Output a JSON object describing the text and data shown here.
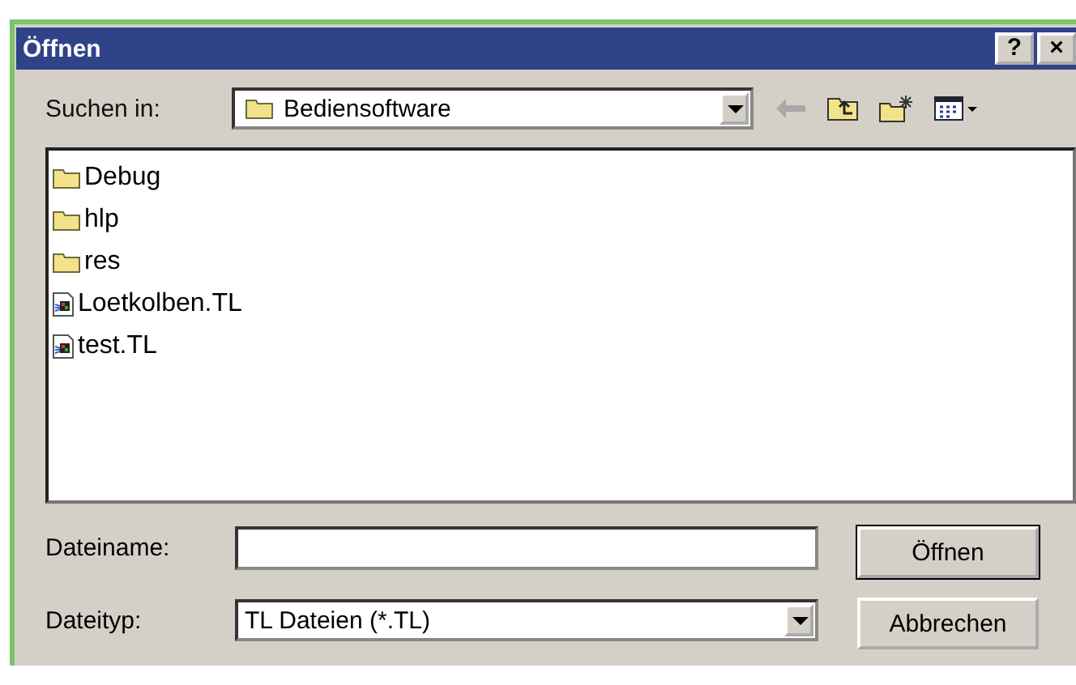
{
  "window": {
    "title": "Öffnen",
    "title_buttons": [
      "?",
      "×"
    ]
  },
  "look_in": {
    "label": "Suchen in:",
    "value": "Bediensoftware"
  },
  "files": [
    {
      "name": "Debug",
      "kind": "folder"
    },
    {
      "name": "hlp",
      "kind": "folder"
    },
    {
      "name": "res",
      "kind": "folder"
    },
    {
      "name": "Loetkolben.TL",
      "kind": "file"
    },
    {
      "name": "test.TL",
      "kind": "file"
    }
  ],
  "filename": {
    "label": "Dateiname:"
  },
  "filetype": {
    "label": "Dateityp:",
    "value": "TL Dateien (*.TL)"
  },
  "buttons": [
    "Öffnen",
    "Abbrechen"
  ]
}
